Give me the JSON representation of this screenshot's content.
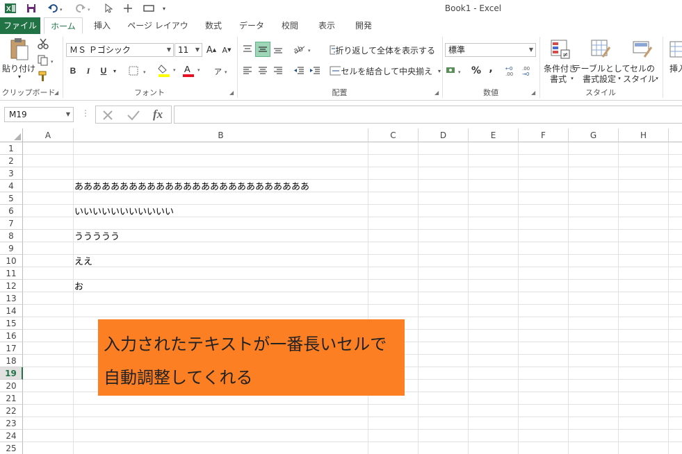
{
  "window": {
    "title": "Book1 - Excel"
  },
  "quick_access": {
    "excel_icon": "excel-icon",
    "save_icon": "save-icon",
    "undo_icon": "undo-icon",
    "redo_icon": "redo-icon"
  },
  "tabs": [
    "ファイル",
    "ホーム",
    "挿入",
    "ページ レイアウト",
    "数式",
    "データ",
    "校閲",
    "表示",
    "開発"
  ],
  "ribbon": {
    "clipboard": {
      "paste_label": "貼り付け",
      "group_label": "クリップボード"
    },
    "font": {
      "font_name": "ＭＳ Ｐゴシック",
      "font_size": "11",
      "bold": "B",
      "italic": "I",
      "underline": "U",
      "group_label": "フォント"
    },
    "alignment": {
      "wrap_text": "折り返して全体を表示する",
      "merge_center": "セルを結合して中央揃え",
      "group_label": "配置"
    },
    "number": {
      "format": "標準",
      "percent": "%",
      "comma": ",",
      "group_label": "数値"
    },
    "styles": {
      "conditional_1": "条件付き",
      "conditional_2": "書式",
      "table_1": "テーブルとして",
      "table_2": "書式設定",
      "cell_1": "セルの",
      "cell_2": "スタイル",
      "group_label": "スタイル"
    },
    "cells": {
      "insert_label": "挿入"
    }
  },
  "formula_bar": {
    "name_box": "M19",
    "fx": "fx",
    "value": ""
  },
  "grid": {
    "columns": [
      "A",
      "B",
      "C",
      "D",
      "E",
      "F",
      "G",
      "H"
    ],
    "rows": [
      "1",
      "2",
      "3",
      "4",
      "5",
      "6",
      "7",
      "8",
      "9",
      "10",
      "11",
      "12",
      "13",
      "14",
      "15",
      "16",
      "17",
      "18",
      "19",
      "20",
      "21",
      "22",
      "23",
      "24",
      "25"
    ],
    "active_row": "19",
    "cells": {
      "B4": "ああああああああああああああああああああああああああ",
      "B6": "いいいいいいいいいいい",
      "B8": "ううううう",
      "B10": "ええ",
      "B12": "お"
    }
  },
  "annotation": {
    "line1": "入力されたテキストが一番長いセルで",
    "line2": "自動調整してくれる",
    "color": "#fd7f24"
  },
  "colors": {
    "excel_green": "#217346",
    "font_color_red": "#e81123",
    "highlight_yellow": "#ffff00"
  }
}
